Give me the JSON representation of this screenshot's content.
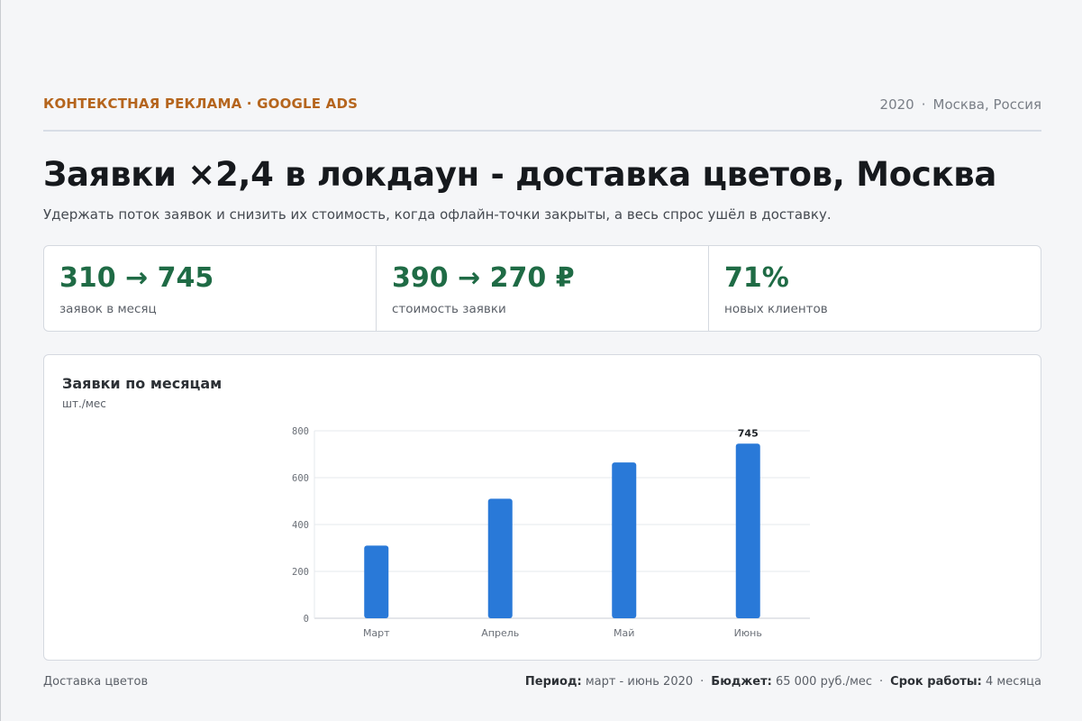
{
  "header": {
    "eyebrow": "КОНТЕКСТНАЯ РЕКЛАМА · GOOGLE ADS",
    "year": "2020",
    "location": "Москва, Россия"
  },
  "title": "Заявки ×2,4 в локдаун - доставка цветов, Москва",
  "subtitle": "Удержать поток заявок и снизить их стоимость, когда офлайн-точки закрыты, а весь спрос ушёл в доставку.",
  "kpis": [
    {
      "value": "310 → 745",
      "label": "заявок в месяц"
    },
    {
      "value": "390 → 270 ₽",
      "label": "стоимость заявки"
    },
    {
      "value": "71%",
      "label": "новых клиентов"
    }
  ],
  "chart_data": {
    "type": "bar",
    "title": "Заявки по месяцам",
    "unit": "шт./мес",
    "categories": [
      "Март",
      "Апрель",
      "Май",
      "Июнь"
    ],
    "values": [
      310,
      510,
      665,
      745
    ],
    "data_labels": [
      null,
      null,
      null,
      "745"
    ],
    "ylim": [
      0,
      800
    ],
    "yticks": [
      0,
      200,
      400,
      600,
      800
    ],
    "grid": true,
    "bar_color": "#2979d8"
  },
  "footer": {
    "left": "Доставка цветов",
    "period_label": "Период:",
    "period_value": "март - июнь 2020",
    "budget_label": "Бюджет:",
    "budget_value": "65 000 руб./мес",
    "term_label": "Срок работы:",
    "term_value": "4 месяца"
  }
}
